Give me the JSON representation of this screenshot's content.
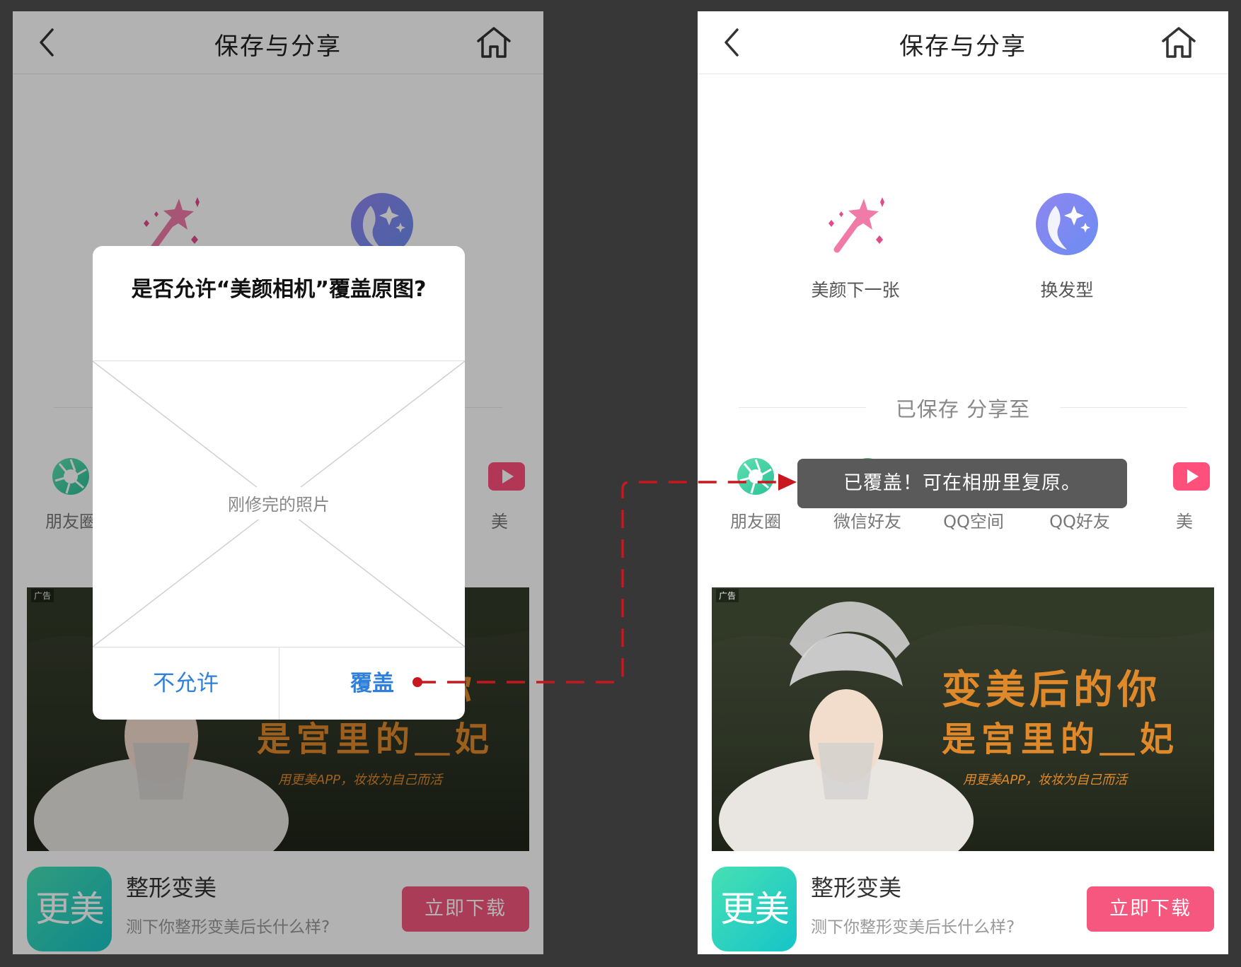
{
  "colors": {
    "background": "#373737",
    "accent_pink": "#f5577e",
    "dialog_button": "#2f7fdc",
    "connector": "#c8171e",
    "toast": "#5a5a5a"
  },
  "header": {
    "title": "保存与分享",
    "back_icon": "chevron-left-icon",
    "home_icon": "home-icon"
  },
  "features": [
    {
      "label": "美颜下一张",
      "icon": "magic-wand-icon"
    },
    {
      "label": "换发型",
      "icon": "hairstyle-icon"
    }
  ],
  "saved_label": "已保存 分享至",
  "share_targets": [
    {
      "label": "朋友圈",
      "icon": "moments-icon"
    },
    {
      "label": "微信好友",
      "icon": "wechat-icon"
    },
    {
      "label": "QQ空间",
      "icon": "qzone-icon"
    },
    {
      "label": "QQ好友",
      "icon": "qq-icon"
    },
    {
      "label": "美",
      "icon": "meipai-icon"
    }
  ],
  "ad": {
    "tag": "广告",
    "headline1": "变美后的你",
    "headline2": "是宫里的＿妃",
    "slogan": "用更美APP，妆妆为自己而活",
    "app_icon_text": "更美",
    "app_title": "整形变美",
    "app_desc": "测下你整形变美后长什么样?",
    "download_label": "立即下载"
  },
  "dialog": {
    "title": "是否允许“美颜相机”覆盖原图?",
    "photo_label": "刚修完的照片",
    "deny_label": "不允许",
    "cover_label": "覆盖"
  },
  "toast": {
    "text": "已覆盖！可在相册里复原。"
  }
}
